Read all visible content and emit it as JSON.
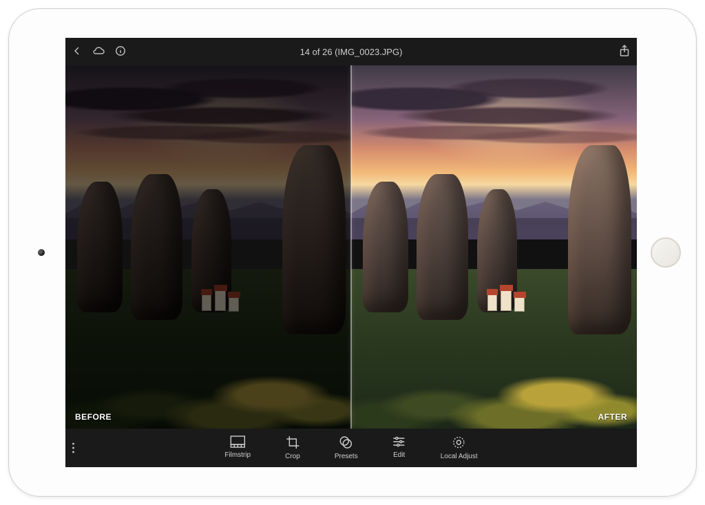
{
  "header": {
    "title": "14 of 26 (IMG_0023.JPG)"
  },
  "compare": {
    "before_label": "BEFORE",
    "after_label": "AFTER"
  },
  "toolbar": {
    "items": [
      {
        "key": "filmstrip",
        "label": "Filmstrip"
      },
      {
        "key": "crop",
        "label": "Crop"
      },
      {
        "key": "presets",
        "label": "Presets"
      },
      {
        "key": "edit",
        "label": "Edit"
      },
      {
        "key": "localadjust",
        "label": "Local Adjust"
      }
    ]
  }
}
